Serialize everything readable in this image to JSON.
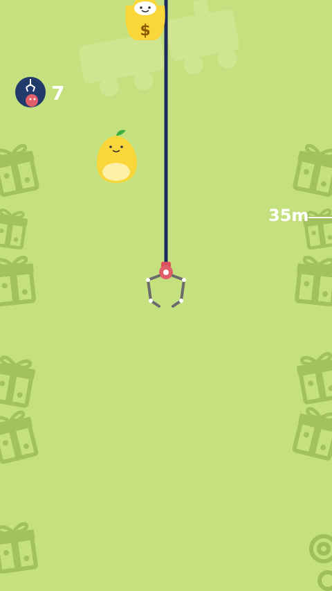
{
  "hud": {
    "claw_count": "7",
    "claw_icon": "claw-machine-icon"
  },
  "depth": {
    "label": "35m"
  },
  "prizes": {
    "money_bag_symbol": "$",
    "money_bag_icon": "money-bag-character",
    "pear_icon": "pear-character"
  },
  "colors": {
    "background": "#c5e07e",
    "decor": "#9fbf5c",
    "rope": "#1f2a5c",
    "claw_body": "#e0606a",
    "prize_yellow": "#f9d63a"
  }
}
